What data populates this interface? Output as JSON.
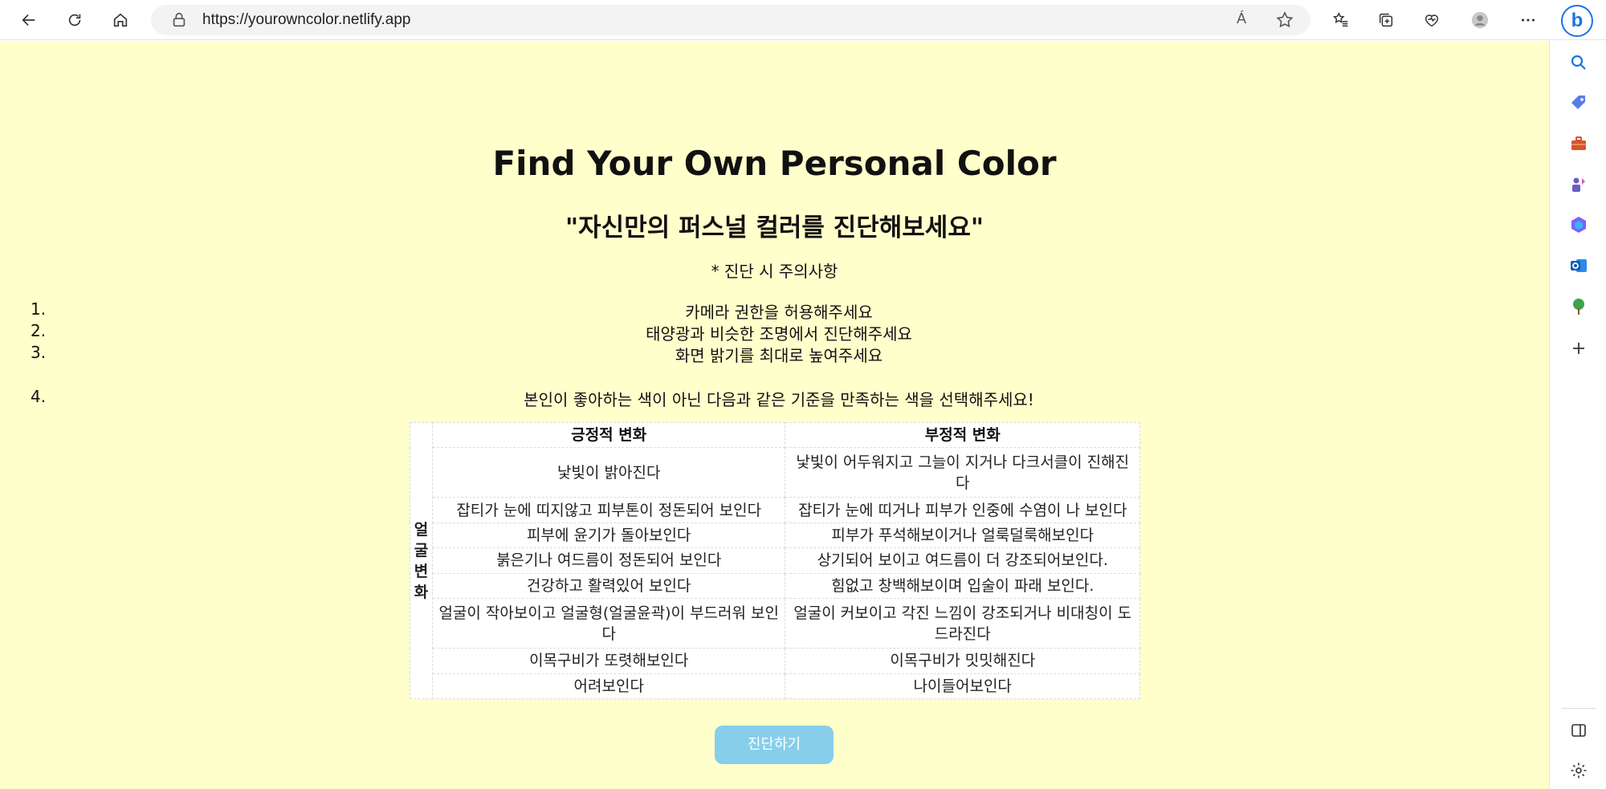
{
  "browser": {
    "url": "https://yourowncolor.netlify.app",
    "read_aloud_glyph": "Á"
  },
  "page": {
    "title": "Find Your Own Personal Color",
    "subtitle": "\"자신만의 퍼스널 컬러를 진단해보세요\"",
    "notice": "* 진단 시 주의사항",
    "list": [
      {
        "num": "1.",
        "text": "카메라 권한을 허용해주세요"
      },
      {
        "num": "2.",
        "text": "태양광과 비슷한 조명에서 진단해주세요"
      },
      {
        "num": "3.",
        "text": "화면 밝기를 최대로 높여주세요"
      },
      {
        "num": "4.",
        "text": "본인이 좋아하는 색이 아닌 다음과 같은 기준을 만족하는 색을 선택해주세요!"
      }
    ],
    "table": {
      "side_label": [
        "얼",
        "굴",
        "변",
        "화"
      ],
      "headers": [
        "긍정적 변화",
        "부정적 변화"
      ],
      "rows": [
        [
          "낯빛이 밝아진다",
          "낯빛이 어두워지고 그늘이 지거나 다크서클이 진해진다"
        ],
        [
          "잡티가 눈에 띠지않고 피부톤이 정돈되어 보인다",
          "잡티가 눈에 띠거나 피부가 인중에 수염이 나 보인다"
        ],
        [
          "피부에 윤기가 돌아보인다",
          "피부가 푸석해보이거나 얼룩덜룩해보인다"
        ],
        [
          "붉은기나 여드름이 정돈되어 보인다",
          "상기되어 보이고 여드름이 더 강조되어보인다."
        ],
        [
          "건강하고 활력있어 보인다",
          "힘없고 창백해보이며 입술이 파래 보인다."
        ],
        [
          "얼굴이 작아보이고 얼굴형(얼굴윤곽)이 부드러워 보인다",
          "얼굴이 커보이고 각진 느낌이 강조되거나 비대칭이 도드라진다"
        ],
        [
          "이목구비가 또렷해보인다",
          "이목구비가 밋밋해진다"
        ],
        [
          "어려보인다",
          "나이들어보인다"
        ]
      ]
    },
    "button_label": "진단하기"
  },
  "colors": {
    "page_bg": "#ffffcc",
    "button_bg": "#87ceeb",
    "button_text": "#ffffff"
  },
  "icons": {
    "toolbar": [
      "back-arrow-icon",
      "refresh-icon",
      "home-icon",
      "lock-icon",
      "read-aloud-icon",
      "favorite-star-icon",
      "favorites-list-icon",
      "collections-icon",
      "browser-essentials-icon",
      "profile-avatar-icon",
      "more-menu-icon",
      "bing-copilot-icon"
    ],
    "sidebar": [
      "search-icon",
      "shopping-tag-icon",
      "tools-briefcase-icon",
      "games-icon",
      "office-icon",
      "outlook-icon",
      "tree-icon",
      "add-icon",
      "split-screen-icon",
      "settings-gear-icon"
    ]
  }
}
